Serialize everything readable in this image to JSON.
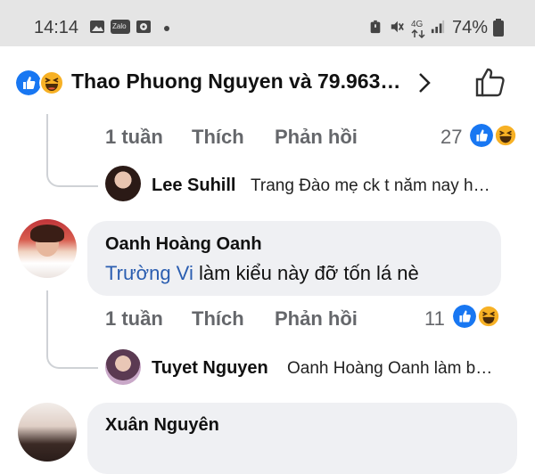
{
  "status": {
    "time": "14:14",
    "network": "4G",
    "battery": "74%",
    "zalo_label": "Zalo"
  },
  "header": {
    "reactors_text": "Thao Phuong Nguyen và 79.963…"
  },
  "threads": [
    {
      "meta": {
        "time": "1 tuần",
        "like": "Thích",
        "reply": "Phản hồi",
        "count": "27"
      },
      "reply_preview": {
        "author": "Lee Suhill",
        "text": "Trang Đào mẹ ck t năm nay h…"
      }
    },
    {
      "author": "Oanh Hoàng Oanh",
      "mention": "Trường Vi",
      "text": " làm kiểu này đỡ tốn lá nè",
      "meta": {
        "time": "1 tuần",
        "like": "Thích",
        "reply": "Phản hồi",
        "count": "11"
      },
      "reply_preview": {
        "author": "Tuyet Nguyen",
        "text": "Oanh Hoàng Oanh làm b…"
      }
    },
    {
      "author": "Xuân Nguyên"
    }
  ],
  "colors": {
    "like_blue": "#1877f2",
    "haha_yellow": "#f7b125",
    "bubble_bg": "#eff0f3"
  }
}
